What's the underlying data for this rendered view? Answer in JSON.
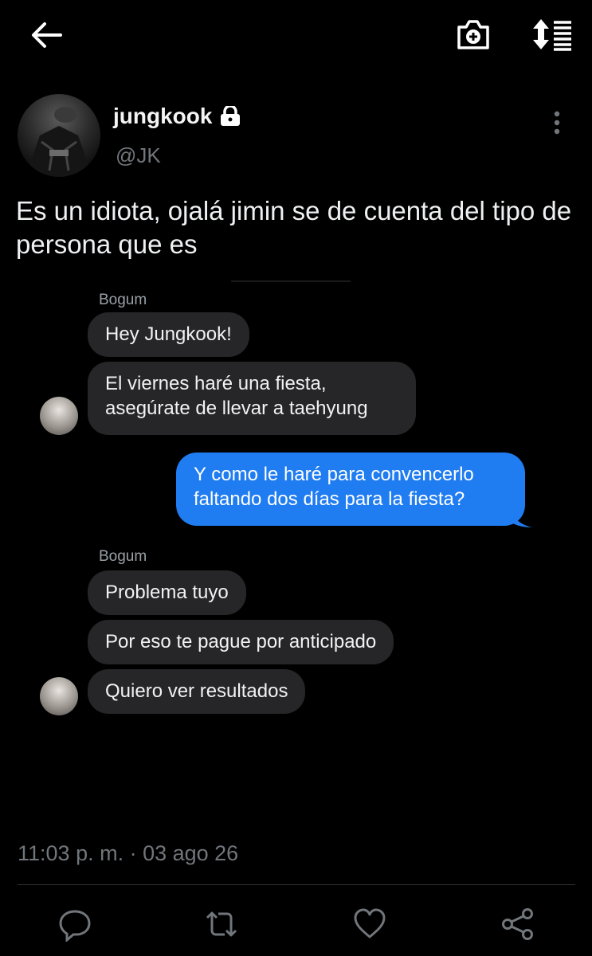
{
  "topbar": {
    "back_icon": "arrow-left-icon",
    "camera_icon": "camera-plus-icon",
    "sort_icon": "sort-list-icon"
  },
  "author": {
    "display_name": "jungkook",
    "handle": "@JK",
    "lock_icon": "lock-icon"
  },
  "tweet": {
    "text": "Es un idiota, ojalá jimin se de cuenta del tipo de persona que es",
    "timestamp": "11:03 p. m. · 03 ago 26"
  },
  "chat": {
    "group1": {
      "sender": "Bogum",
      "messages": [
        "Hey Jungkook!",
        "El viernes haré una fiesta,",
        "asegúrate de llevar a taehyung"
      ]
    },
    "outgoing": {
      "lines": [
        "Y como le haré para convencerlo",
        "faltando dos días para la fiesta?"
      ]
    },
    "group2": {
      "sender": "Bogum",
      "messages": [
        "Problema tuyo",
        "Por eso te pague por anticipado",
        "Quiero ver resultados"
      ]
    },
    "colors": {
      "incoming": "#262628",
      "outgoing": "#1f7cf1"
    }
  },
  "actions": [
    "reply-icon",
    "retweet-icon",
    "like-icon",
    "share-icon"
  ]
}
